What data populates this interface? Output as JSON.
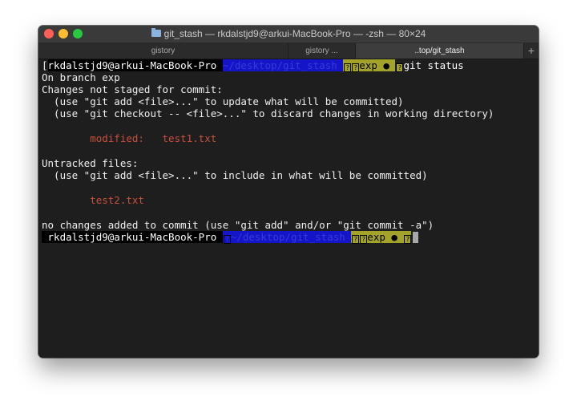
{
  "window": {
    "title": "git_stash — rkdalstjd9@arkui-MacBook-Pro — -zsh — 80×24"
  },
  "tabs": [
    {
      "label": "gistory"
    },
    {
      "label": "gistory ..."
    },
    {
      "label": "..top/git_stash"
    }
  ],
  "icons": {
    "folder": "folder-icon",
    "close": "close-button",
    "minimize": "minimize-button",
    "zoom": "zoom-button",
    "add_tab": "plus-icon"
  },
  "colors": {
    "user_segment_bg": "#000000",
    "path_segment_bg": "#1414c8",
    "git_segment_bg": "#a3a32a",
    "file_status_red": "#c9503d"
  },
  "terminal": {
    "prompt1": {
      "open_bracket": "[",
      "user": "rkdalstjd9@arkui-MacBook-Pro ",
      "path": "~/desktop/git_stash ",
      "glyph": "?",
      "branch": "exp ● ",
      "command": "git status"
    },
    "output": {
      "on_branch": "On branch exp",
      "not_staged_header": "Changes not staged for commit:",
      "hint_add": "  (use \"git add <file>...\" to update what will be committed)",
      "hint_checkout": "  (use \"git checkout -- <file>...\" to discard changes in working directory)",
      "modified_line": "        modified:   test1.txt",
      "untracked_header": "Untracked files:",
      "hint_untracked": "  (use \"git add <file>...\" to include in what will be committed)",
      "untracked_file": "        test2.txt",
      "no_changes": "no changes added to commit (use \"git add\" and/or \"git commit -a\")"
    },
    "prompt2": {
      "user": " rkdalstjd9@arkui-MacBook-Pro ",
      "path": "~/desktop/git_stash ",
      "glyph": "?",
      "branch": "exp ● "
    }
  }
}
